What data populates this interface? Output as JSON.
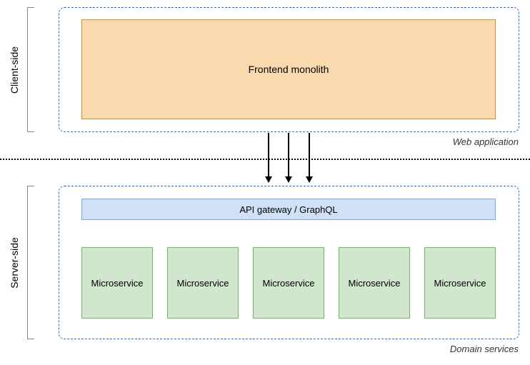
{
  "labels": {
    "client_side": "Client-side",
    "server_side": "Server-side"
  },
  "client": {
    "frontend": "Frontend monolith",
    "caption": "Web application"
  },
  "server": {
    "api_gateway": "API gateway / GraphQL",
    "microservices": [
      "Microservice",
      "Microservice",
      "Microservice",
      "Microservice",
      "Microservice"
    ],
    "caption": "Domain services"
  }
}
